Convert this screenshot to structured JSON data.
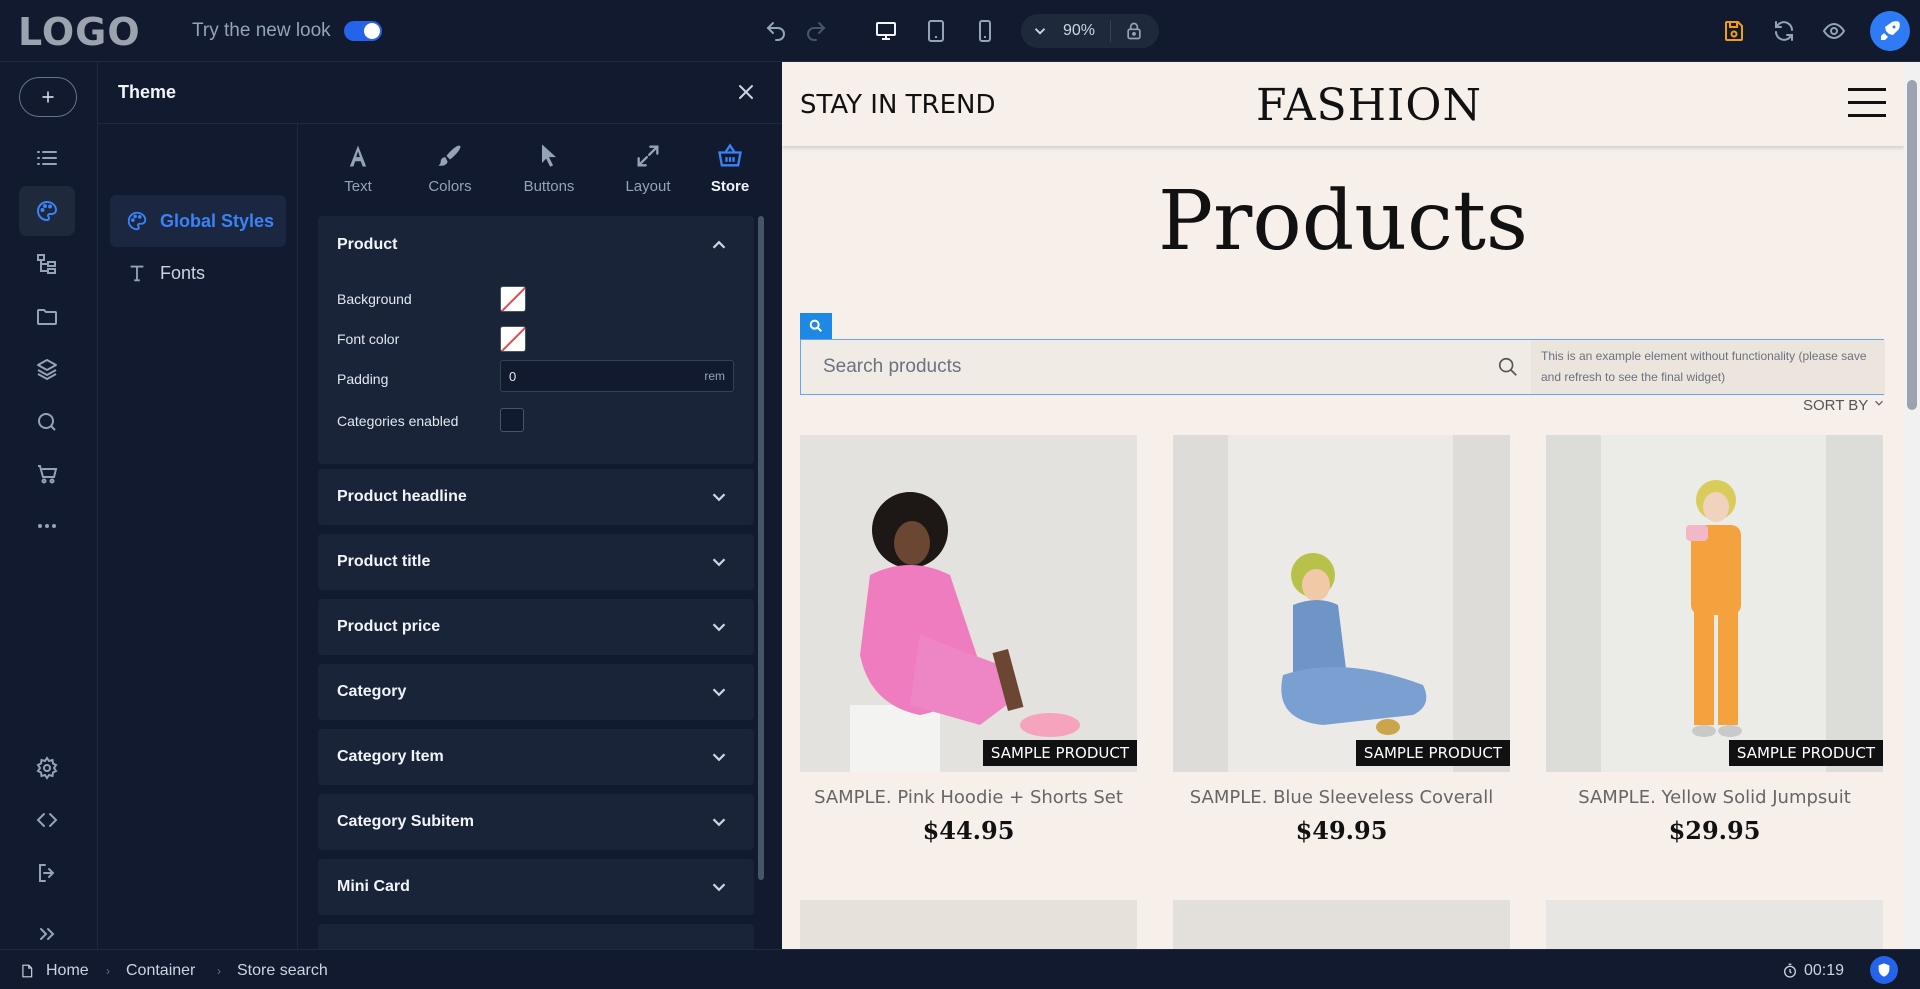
{
  "topbar": {
    "logo": "LOGO",
    "try_new_look": "Try the new look",
    "zoom": "90%"
  },
  "colors": {
    "accent": "#2563eb",
    "panel_bg": "#111a2e",
    "canvas_bg": "#f6efea"
  },
  "panel": {
    "title": "Theme",
    "sub_nav": [
      {
        "label": "Global Styles"
      },
      {
        "label": "Fonts"
      }
    ],
    "tabs": [
      {
        "label": "Text"
      },
      {
        "label": "Colors"
      },
      {
        "label": "Buttons"
      },
      {
        "label": "Layout"
      },
      {
        "label": "Store"
      }
    ],
    "product_section": {
      "title": "Product",
      "background_label": "Background",
      "font_color_label": "Font color",
      "padding_label": "Padding",
      "padding_value": "0",
      "padding_unit": "rem",
      "categories_label": "Categories enabled"
    },
    "sections": [
      {
        "title": "Product headline"
      },
      {
        "title": "Product title"
      },
      {
        "title": "Product price"
      },
      {
        "title": "Category"
      },
      {
        "title": "Category Item"
      },
      {
        "title": "Category Subitem"
      },
      {
        "title": "Mini Card"
      }
    ]
  },
  "site": {
    "tagline": "STAY IN TREND",
    "brand": "FASHION",
    "heading": "Products",
    "search_placeholder": "Search products",
    "search_note": "This is an example element without functionality (please save and refresh to see the final widget)",
    "sort_label": "SORT BY",
    "products": [
      {
        "badge": "SAMPLE PRODUCT",
        "title": "SAMPLE. Pink Hoodie + Shorts Set",
        "price": "$44.95"
      },
      {
        "badge": "SAMPLE PRODUCT",
        "title": "SAMPLE. Blue Sleeveless Coverall",
        "price": "$49.95"
      },
      {
        "badge": "SAMPLE PRODUCT",
        "title": "SAMPLE. Yellow Solid Jumpsuit",
        "price": "$29.95"
      }
    ]
  },
  "statusbar": {
    "breadcrumbs": [
      {
        "label": "Home"
      },
      {
        "label": "Container"
      },
      {
        "label": "Store search"
      }
    ],
    "timer": "00:19"
  }
}
